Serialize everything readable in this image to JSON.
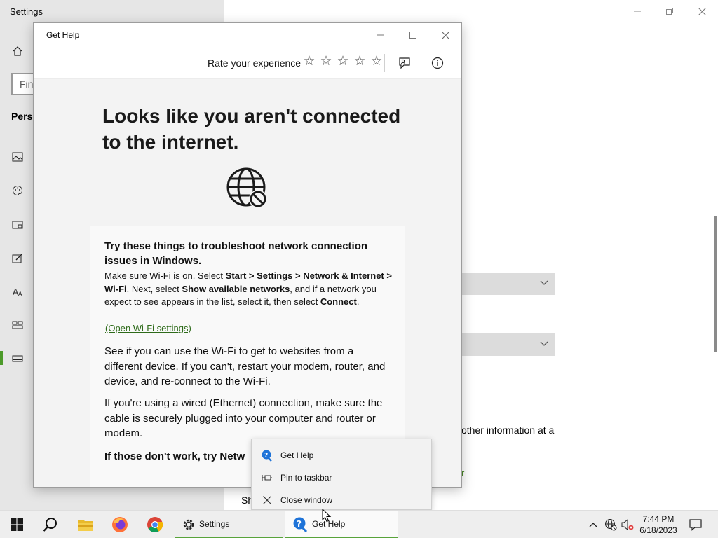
{
  "settings": {
    "title": "Settings",
    "search_placeholder": "Fin",
    "section_label": "Perso",
    "text_fragment": "other information at a",
    "link_fragment": "r",
    "bottom_fragment": "Sh"
  },
  "gethelp": {
    "title": "Get Help",
    "rate_label": "Rate your experience",
    "stars": [
      "☆",
      "☆",
      "☆",
      "☆",
      "☆"
    ],
    "heading": "Looks like you aren't connected to the internet.",
    "card": {
      "title": "Try these things to troubleshoot network connection issues in Windows.",
      "p1_a": "Make sure Wi-Fi is on. Select ",
      "p1_b": "Start > Settings > Network & Internet > Wi-Fi",
      "p1_c": ". Next, select ",
      "p1_d": "Show available networks",
      "p1_e": ", and if a network you expect to see appears in the list, select it, then select ",
      "p1_f": "Connect",
      "p1_g": ".",
      "link": "(Open Wi-Fi settings)",
      "p2": "See if you can use the Wi-Fi to get to websites from a different device. If you can't, restart your modem, router, and device, and re-connect to the Wi-Fi.",
      "p3": "If you're using a wired (Ethernet) connection, make sure the cable is securely plugged into your computer and router or modem.",
      "p4": "If those don't work, try Netw"
    }
  },
  "context_menu": {
    "items": [
      {
        "label": "Get Help",
        "icon": "get-help-icon"
      },
      {
        "label": "Pin to taskbar",
        "icon": "pin-icon"
      },
      {
        "label": "Close window",
        "icon": "close-icon"
      }
    ]
  },
  "taskbar": {
    "apps": [
      {
        "label": "Settings",
        "icon": "gear-icon"
      },
      {
        "label": "Get Help",
        "icon": "get-help-icon"
      }
    ],
    "clock_time": "7:44 PM",
    "clock_date": "6/18/2023"
  },
  "colors": {
    "accent": "#58a33a",
    "link": "#2e6b1a",
    "help_blue": "#1e73d8"
  }
}
